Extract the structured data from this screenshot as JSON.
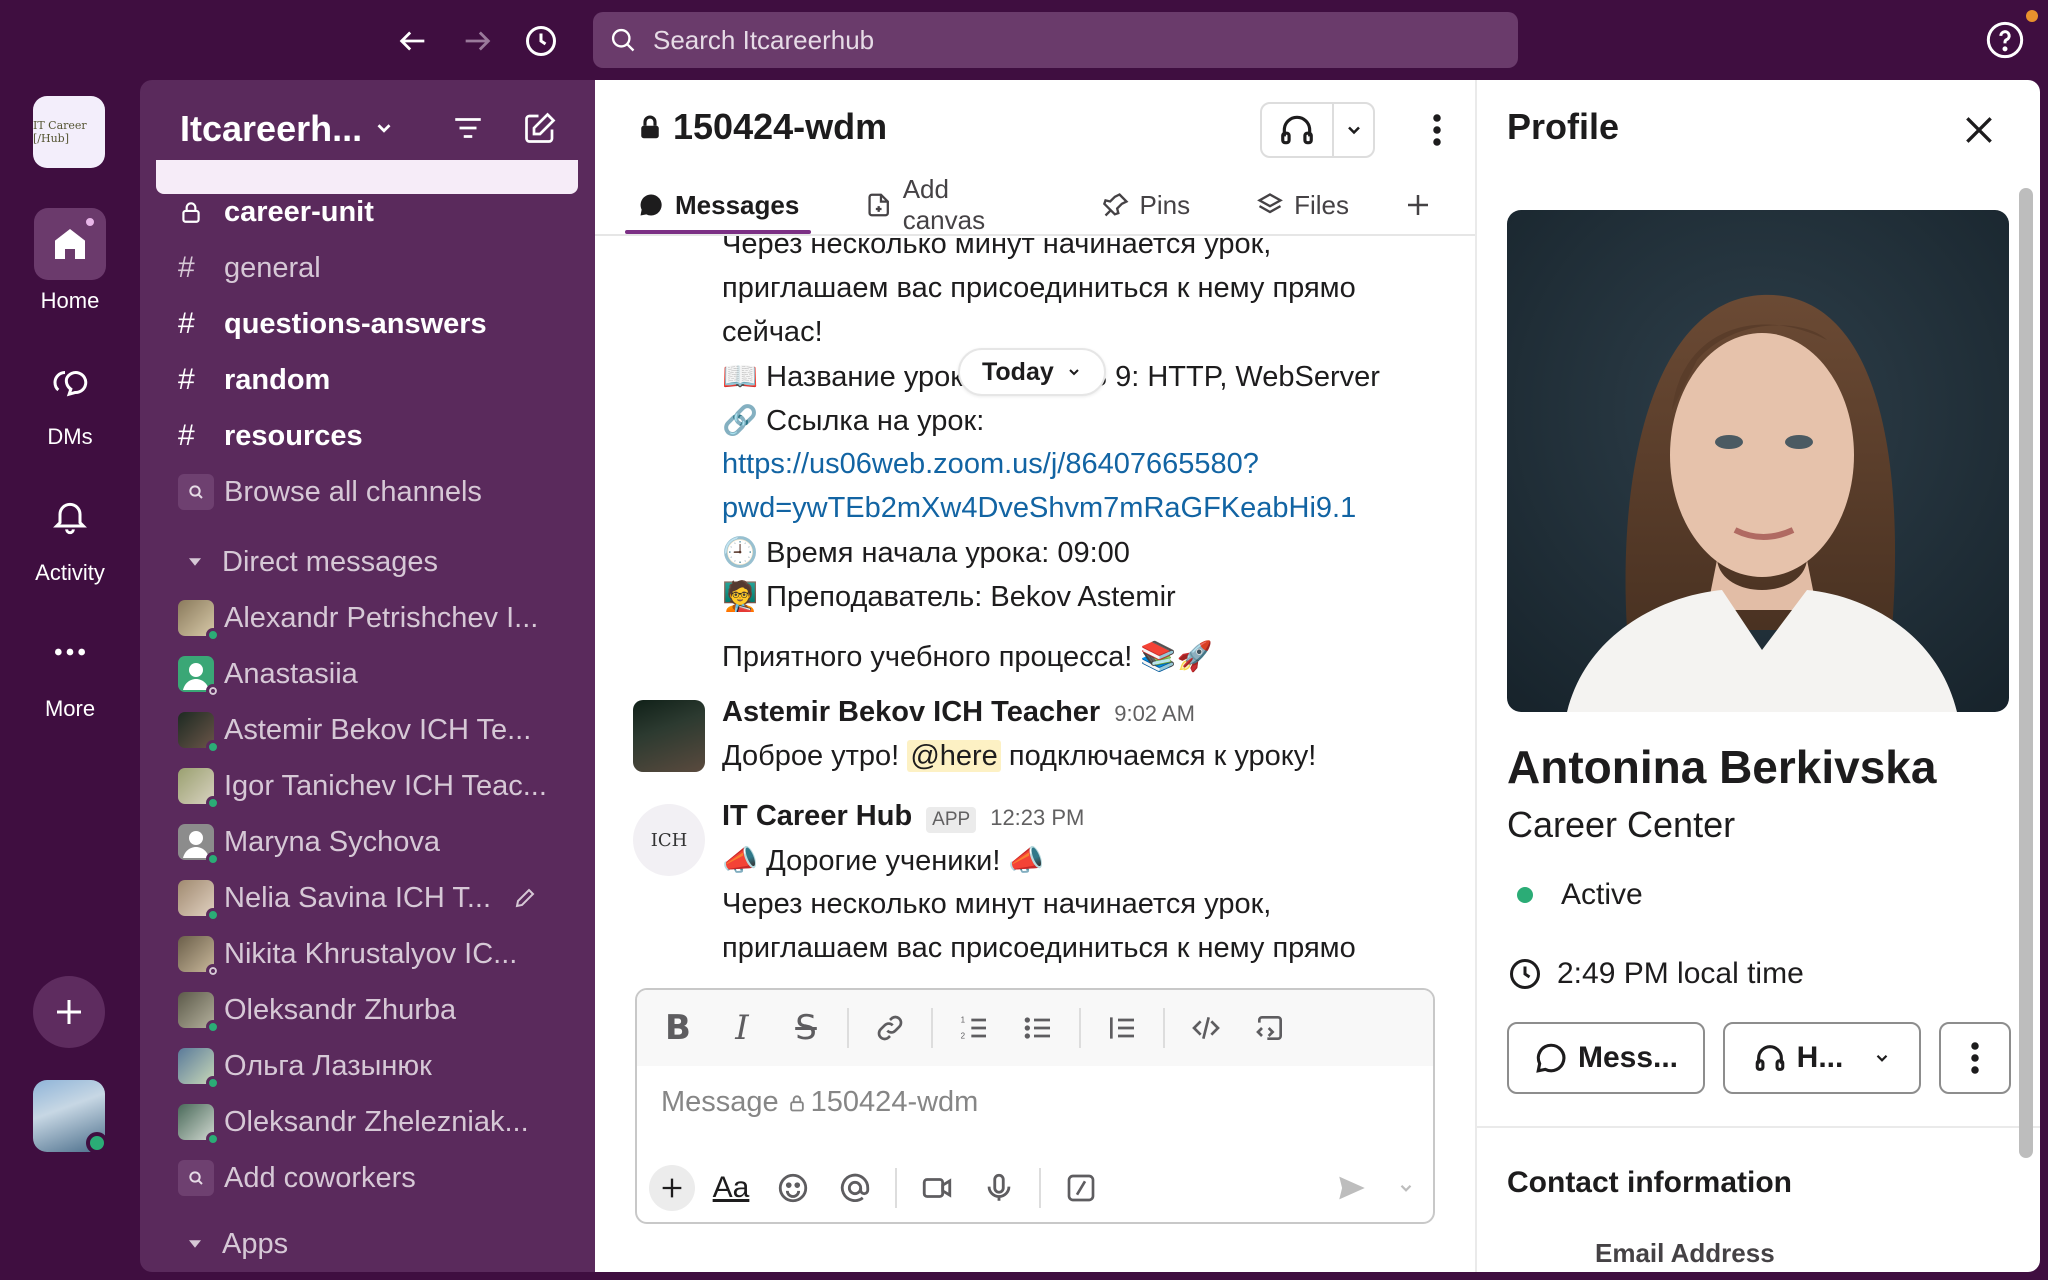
{
  "search": {
    "placeholder": "Search Itcareerhub"
  },
  "rail": {
    "logo_text": "IT Career [/Hub]",
    "items": [
      {
        "label": "Home",
        "icon": "home-icon"
      },
      {
        "label": "DMs",
        "icon": "dms-icon"
      },
      {
        "label": "Activity",
        "icon": "bell-icon"
      },
      {
        "label": "More",
        "icon": "more-icon"
      }
    ]
  },
  "sidebar": {
    "workspace_name": "Itcareerh...",
    "channels": [
      {
        "name": "career-unit",
        "icon": "lock",
        "bold": true
      },
      {
        "name": "general",
        "icon": "#",
        "bold": false
      },
      {
        "name": "questions-answers",
        "icon": "#",
        "bold": true
      },
      {
        "name": "random",
        "icon": "#",
        "bold": true
      },
      {
        "name": "resources",
        "icon": "#",
        "bold": true
      }
    ],
    "browse_label": "Browse all channels",
    "dm_section_label": "Direct messages",
    "dms": [
      {
        "name": "Alexandr Petrishchev I...",
        "status": "on"
      },
      {
        "name": "Anastasiia",
        "status": "off"
      },
      {
        "name": "Astemir Bekov ICH Te...",
        "status": "on"
      },
      {
        "name": "Igor Tanichev ICH Teac...",
        "status": "on"
      },
      {
        "name": "Maryna Sychova",
        "status": "on"
      },
      {
        "name": "Nelia Savina ICH T...",
        "status": "on",
        "draft": true
      },
      {
        "name": "Nikita Khrustalyov IC...",
        "status": "off"
      },
      {
        "name": "Oleksandr Zhurba",
        "status": "on"
      },
      {
        "name": "Ольга Лазынюк",
        "status": "on"
      },
      {
        "name": "Oleksandr Zhelezniak...",
        "status": "on"
      }
    ],
    "add_coworkers_label": "Add coworkers",
    "apps_label": "Apps"
  },
  "channel": {
    "name": "150424-wdm",
    "tabs": [
      {
        "label": "Messages",
        "active": true
      },
      {
        "label": "Add canvas"
      },
      {
        "label": "Pins"
      },
      {
        "label": "Files"
      }
    ],
    "today_label": "Today"
  },
  "messages": {
    "prev_lines": [
      "Через несколько минут начинается урок,",
      "приглашаем вас присоединиться к нему прямо",
      "сейчас!",
      "📖 Название урока: Node.JS 9: HTTP, WebServer",
      "🔗 Ссылка на урок:"
    ],
    "prev_link_1": "https://us06web.zoom.us/j/86407665580?",
    "prev_link_2": "pwd=ywTEb2mXw4DveShvm7mRaGFKeabHi9.1",
    "prev_time_line": "🕘 Время начала урока: 09:00",
    "prev_teacher_line": "🧑‍🏫 Преподаватель: Bekov Astemir",
    "prev_closing": "Приятного учебного процесса! 📚🚀",
    "msg1": {
      "sender": "Astemir Bekov ICH Teacher",
      "time": "9:02 AM",
      "text_before": "Доброе утро!",
      "mention": "@here",
      "text_after": "подключаемся к уроку!"
    },
    "msg2": {
      "sender": "IT Career Hub",
      "badge": "APP",
      "time": "12:23 PM",
      "avatar_text": "ICH",
      "line1": "📣 Дорогие ученики! 📣",
      "line2": "Через несколько минут начинается урок,",
      "line3": "приглашаем вас присоединиться к нему прямо"
    }
  },
  "composer": {
    "placeholder": "Message",
    "channel": "150424-wdm"
  },
  "profile": {
    "title": "Profile",
    "name": "Antonina Berkivska",
    "role": "Career Center",
    "status": "Active",
    "local_time": "2:49 PM local time",
    "message_btn": "Mess...",
    "huddle_btn": "H...",
    "contact_heading": "Contact information",
    "email_label": "Email Address"
  }
}
